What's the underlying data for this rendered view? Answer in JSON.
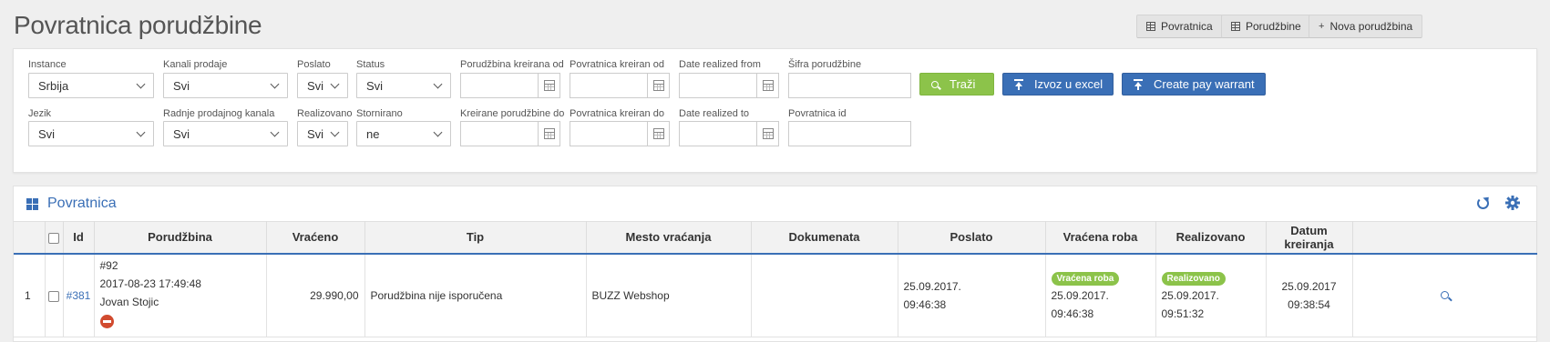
{
  "page": {
    "title": "Povratnica porudžbine"
  },
  "top_buttons": {
    "povratnica": "Povratnica",
    "porudzbine": "Porudžbine",
    "nova": "Nova porudžbina",
    "nova_icon": "+"
  },
  "filters": {
    "instance": {
      "label": "Instance",
      "value": "Srbija"
    },
    "kanali": {
      "label": "Kanali prodaje",
      "value": "Svi"
    },
    "poslato": {
      "label": "Poslato",
      "value": "Svi"
    },
    "status": {
      "label": "Status",
      "value": "Svi"
    },
    "porudzbina_kreirana_od": {
      "label": "Porudžbina kreirana od",
      "value": ""
    },
    "povratnica_kreiran_od": {
      "label": "Povratnica kreiran od",
      "value": ""
    },
    "date_realized_from": {
      "label": "Date realized from",
      "value": ""
    },
    "sifra": {
      "label": "Šifra porudžbine",
      "value": ""
    },
    "jezik": {
      "label": "Jezik",
      "value": "Svi"
    },
    "radnje": {
      "label": "Radnje prodajnog kanala",
      "value": "Svi"
    },
    "realizovano": {
      "label": "Realizovano",
      "value": "Svi"
    },
    "stornirano": {
      "label": "Stornirano",
      "value": "ne"
    },
    "kreirane_do": {
      "label": "Kreirane porudžbine do",
      "value": ""
    },
    "povratnica_kreiran_do": {
      "label": "Povratnica kreiran do",
      "value": ""
    },
    "date_realized_to": {
      "label": "Date realized to",
      "value": ""
    },
    "povratnica_id": {
      "label": "Povratnica id",
      "value": ""
    }
  },
  "actions": {
    "trazi": "Traži",
    "izvoz": "Izvoz u excel",
    "pay_warrant": "Create pay warrant"
  },
  "colors": {
    "accent": "#3a6fb6",
    "green": "#8cc34a",
    "danger": "#d14b2f"
  },
  "panel": {
    "title": "Povratnica"
  },
  "table": {
    "headers": {
      "id": "Id",
      "porudzbina": "Porudžbina",
      "vraceno": "Vraćeno",
      "tip": "Tip",
      "mesto": "Mesto vraćanja",
      "dokumenata": "Dokumenata",
      "poslato": "Poslato",
      "vracena_roba": "Vraćena roba",
      "realizovano": "Realizovano",
      "datum": "Datum kreiranja"
    },
    "rows": [
      {
        "num": "1",
        "id": "#381",
        "order_no": "#92",
        "order_date": "2017-08-23 17:49:48",
        "customer": "Jovan Stojic",
        "vraceno": "29.990,00",
        "tip": "Porudžbina nije isporučena",
        "mesto": "BUZZ Webshop",
        "dokumenata": "",
        "poslato_date": "25.09.2017.",
        "poslato_time": "09:46:38",
        "vracena_badge": "Vraćena roba",
        "vracena_date": "25.09.2017.",
        "vracena_time": "09:46:38",
        "realizovano_badge": "Realizovano",
        "realizovano_date": "25.09.2017.",
        "realizovano_time": "09:51:32",
        "datum_date": "25.09.2017",
        "datum_time": "09:38:54"
      }
    ]
  }
}
